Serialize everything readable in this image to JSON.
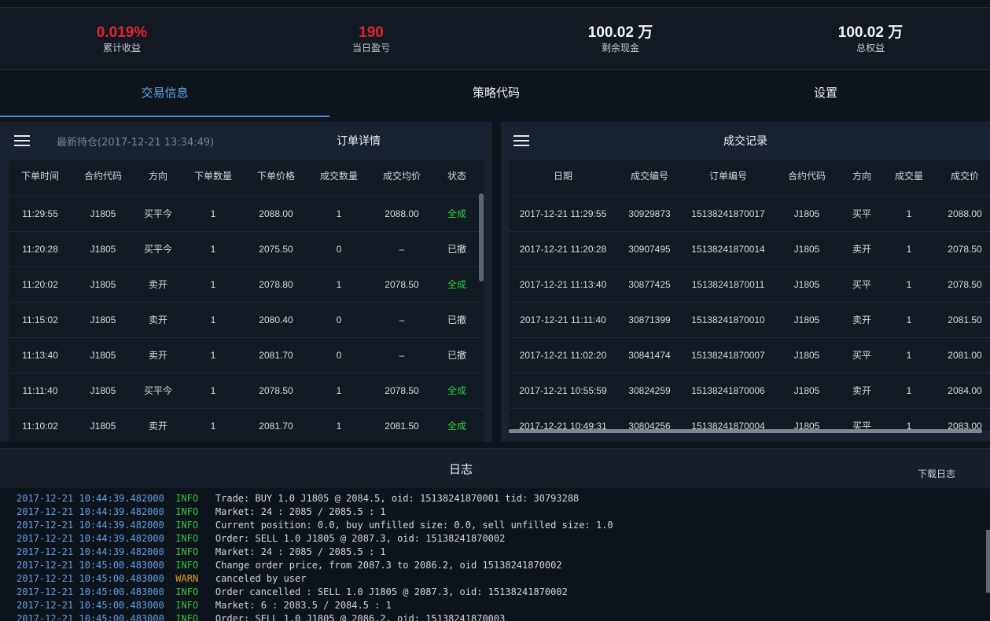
{
  "stats": [
    {
      "value": "0.019%",
      "label": "累计收益",
      "color": "#e0262c"
    },
    {
      "value": "190",
      "label": "当日盈亏",
      "color": "#e0262c"
    },
    {
      "value": "100.02 万",
      "label": "剩余现金",
      "color": "#f2f4f6"
    },
    {
      "value": "100.02 万",
      "label": "总权益",
      "color": "#f2f4f6"
    }
  ],
  "tabs": [
    {
      "label": "交易信息",
      "active": true
    },
    {
      "label": "策略代码",
      "active": false
    },
    {
      "label": "设置",
      "active": false
    }
  ],
  "orders": {
    "subtitle": "最新持仓(2017-12-21 13:34:49)",
    "title": "订单详情",
    "columns": [
      "下单时间",
      "合约代码",
      "方向",
      "下单数量",
      "下单价格",
      "成交数量",
      "成交均价",
      "状态"
    ],
    "rows": [
      [
        "11:29:55",
        "J1805",
        "买平今",
        "1",
        "2088.00",
        "1",
        "2088.00",
        "全成"
      ],
      [
        "11:20:28",
        "J1805",
        "买平今",
        "1",
        "2075.50",
        "0",
        "–",
        "已撤"
      ],
      [
        "11:20:02",
        "J1805",
        "卖开",
        "1",
        "2078.80",
        "1",
        "2078.50",
        "全成"
      ],
      [
        "11:15:02",
        "J1805",
        "卖开",
        "1",
        "2080.40",
        "0",
        "–",
        "已撤"
      ],
      [
        "11:13:40",
        "J1805",
        "卖开",
        "1",
        "2081.70",
        "0",
        "–",
        "已撤"
      ],
      [
        "11:11:40",
        "J1805",
        "买平今",
        "1",
        "2078.50",
        "1",
        "2078.50",
        "全成"
      ],
      [
        "11:10:02",
        "J1805",
        "卖开",
        "1",
        "2081.70",
        "1",
        "2081.50",
        "全成"
      ]
    ]
  },
  "trades": {
    "title": "成交记录",
    "columns": [
      "日期",
      "成交编号",
      "订单编号",
      "合约代码",
      "方向",
      "成交量",
      "成交价"
    ],
    "rows": [
      [
        "2017-12-21 11:29:55",
        "30929873",
        "15138241870017",
        "J1805",
        "买平",
        "1",
        "2088.00"
      ],
      [
        "2017-12-21 11:20:28",
        "30907495",
        "15138241870014",
        "J1805",
        "卖开",
        "1",
        "2078.50"
      ],
      [
        "2017-12-21 11:13:40",
        "30877425",
        "15138241870011",
        "J1805",
        "买平",
        "1",
        "2078.50"
      ],
      [
        "2017-12-21 11:11:40",
        "30871399",
        "15138241870010",
        "J1805",
        "卖开",
        "1",
        "2081.50"
      ],
      [
        "2017-12-21 11:02:20",
        "30841474",
        "15138241870007",
        "J1805",
        "买平",
        "1",
        "2081.00"
      ],
      [
        "2017-12-21 10:55:59",
        "30824259",
        "15138241870006",
        "J1805",
        "卖开",
        "1",
        "2084.00"
      ],
      [
        "2017-12-21 10:49:31",
        "30804256",
        "15138241870004",
        "J1805",
        "买平",
        "1",
        "2083.00"
      ]
    ]
  },
  "log": {
    "title": "日志",
    "download_label": "下载日志",
    "lines": [
      {
        "ts": "2017-12-21 10:44:39.482000",
        "level": "INFO",
        "msg": "Trade: BUY 1.0 J1805 @ 2084.5, oid: 15138241870001 tid: 30793288"
      },
      {
        "ts": "2017-12-21 10:44:39.482000",
        "level": "INFO",
        "msg": "Market: 24 : 2085 / 2085.5 : 1"
      },
      {
        "ts": "2017-12-21 10:44:39.482000",
        "level": "INFO",
        "msg": "Current position: 0.0, buy unfilled size: 0.0, sell unfilled size: 1.0"
      },
      {
        "ts": "2017-12-21 10:44:39.482000",
        "level": "INFO",
        "msg": "Order: SELL 1.0 J1805 @ 2087.3, oid: 15138241870002"
      },
      {
        "ts": "2017-12-21 10:44:39.482000",
        "level": "INFO",
        "msg": "Market: 24 : 2085 / 2085.5 : 1"
      },
      {
        "ts": "2017-12-21 10:45:00.483000",
        "level": "INFO",
        "msg": "Change order price, from 2087.3 to 2086.2, oid 15138241870002"
      },
      {
        "ts": "2017-12-21 10:45:00.483000",
        "level": "WARN",
        "msg": "canceled by user"
      },
      {
        "ts": "2017-12-21 10:45:00.483000",
        "level": "INFO",
        "msg": "Order cancelled : SELL 1.0 J1805 @ 2087.3, oid: 15138241870002"
      },
      {
        "ts": "2017-12-21 10:45:00.483000",
        "level": "INFO",
        "msg": "Market: 6 : 2083.5 / 2084.5 : 1"
      },
      {
        "ts": "2017-12-21 10:45:00.483000",
        "level": "INFO",
        "msg": "Order: SELL 1.0 J1805 @ 2086.2, oid: 15138241870003"
      }
    ]
  },
  "colors": {
    "accent": "#4b8fdb",
    "filled_status": "#2fcf3d",
    "loss_value": "#e0262c",
    "log_timestamp": "#5f9fe8",
    "log_info": "#33c23c",
    "log_warn": "#e39a21"
  }
}
